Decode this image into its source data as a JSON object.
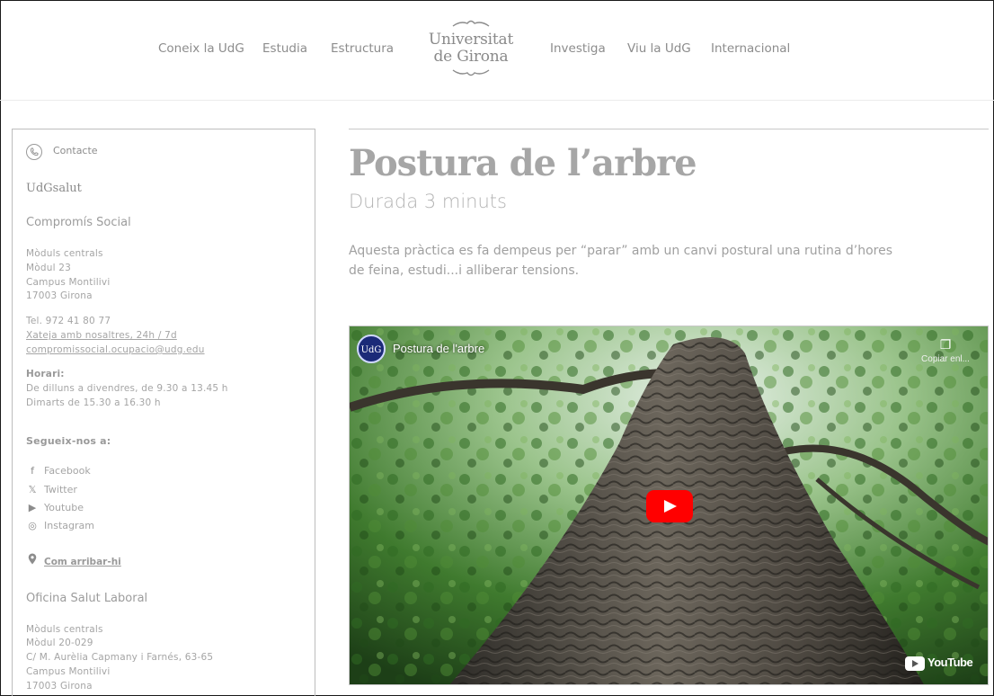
{
  "nav": {
    "left": [
      "Coneix la UdG",
      "Estudia",
      "Estructura"
    ],
    "right": [
      "Investiga",
      "Viu la UdG",
      "Internacional"
    ]
  },
  "logo": {
    "line1": "Universitat",
    "line2": "de Girona"
  },
  "sidebar": {
    "contact_label": "Contacte",
    "udgsalut": "UdGsalut",
    "section1": {
      "title": "Compromís Social",
      "address": [
        "Mòduls centrals",
        "Mòdul 23",
        "Campus Montilivi",
        "17003  Girona"
      ],
      "phone": "Tel. 972 41 80 77",
      "chat": "Xateja amb nosaltres, 24h / 7d",
      "email": "compromissocial.ocupacio@udg.edu",
      "hours_label": "Horari:",
      "hours": [
        "De dilluns a divendres, de 9.30 a 13.45 h",
        "Dimarts de 15.30 a 16.30 h"
      ]
    },
    "follow_label": "Segueix-nos a:",
    "social": [
      {
        "icon": "facebook-icon",
        "glyph": "f",
        "label": "Facebook"
      },
      {
        "icon": "x-icon",
        "glyph": "𝕏",
        "label": "Twitter"
      },
      {
        "icon": "youtube-icon",
        "glyph": "▶",
        "label": "Youtube"
      },
      {
        "icon": "instagram-icon",
        "glyph": "◎",
        "label": "Instagram"
      }
    ],
    "directions": "Com arribar-hi",
    "section2": {
      "title": "Oficina Salut Laboral",
      "address": [
        "Mòduls centrals",
        "Mòdul 20-029",
        "C/ M. Aurèlia Capmany i Farnés, 63-65",
        "Campus Montilivi",
        "17003  Girona"
      ]
    }
  },
  "main": {
    "title": "Postura de l’arbre",
    "subtitle": "Durada 3 minuts",
    "description": "Aquesta pràctica es fa dempeus per “parar” amb un canvi postural una rutina d’hores de feina, estudi...i alliberar tensions."
  },
  "video": {
    "channel_avatar": "UdG",
    "title": "Postura de l'arbre",
    "copy_label": "Copiar enl...",
    "brand": "YouTube"
  }
}
